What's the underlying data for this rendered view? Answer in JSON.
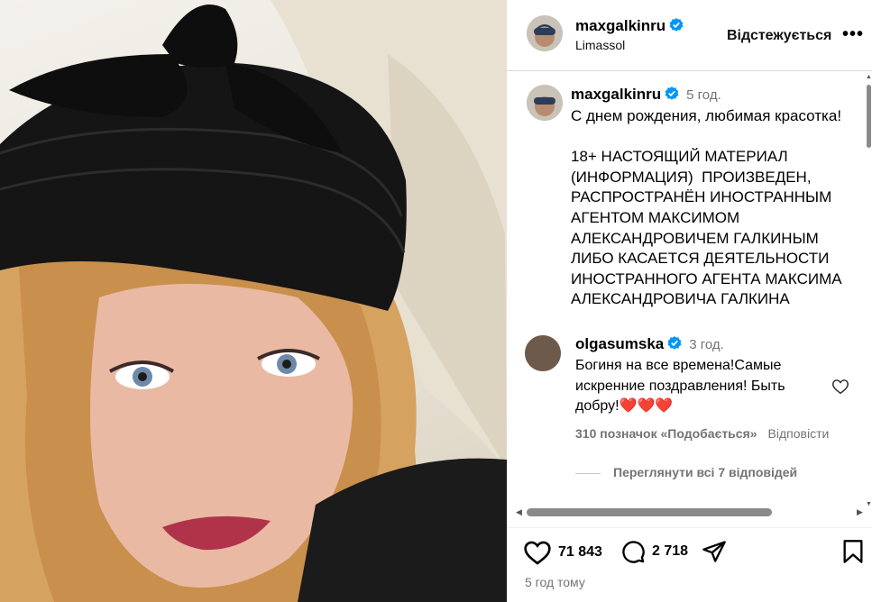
{
  "post": {
    "author": "maxgalkinru",
    "location": "Limassol",
    "follow_label": "Відстежується",
    "more_label": "•••",
    "caption_time": "5 год.",
    "caption": "С днем рождения, любимая красотка!\n\n18+ НАСТОЯЩИЙ МАТЕРИАЛ (ИНФОРМАЦИЯ)  ПРОИЗВЕДЕН, РАСПРОСТРАНЁН ИНОСТРАННЫМ АГЕНТОМ МАКСИМОМ АЛЕКСАНДРОВИЧЕМ ГАЛКИНЫМ ЛИБО КАСАЕТСЯ ДЕЯТЕЛЬНОСТИ ИНОСТРАННОГО АГЕНТА МАКСИМА АЛЕКСАНДРОВИЧА ГАЛКИНА"
  },
  "comment": {
    "author": "olgasumska",
    "time": "3 год.",
    "text": "Богиня на все времена!Самые искренние поздравления! Быть добру!❤️❤️❤️",
    "likes": "310 позначок «Подобається»",
    "reply_label": "Відповісти",
    "view_replies": "Переглянути всі 7 відповідей"
  },
  "actions": {
    "likes_count": "71 843",
    "comments_count": "2 718"
  },
  "posted_ago": "5 год тому",
  "icons": [
    "verified-icon",
    "heart-icon",
    "comment-icon",
    "share-icon",
    "bookmark-icon",
    "more-icon"
  ],
  "colors": {
    "verified": "#0095f6",
    "muted": "#737373",
    "heart": "#e0245e"
  }
}
